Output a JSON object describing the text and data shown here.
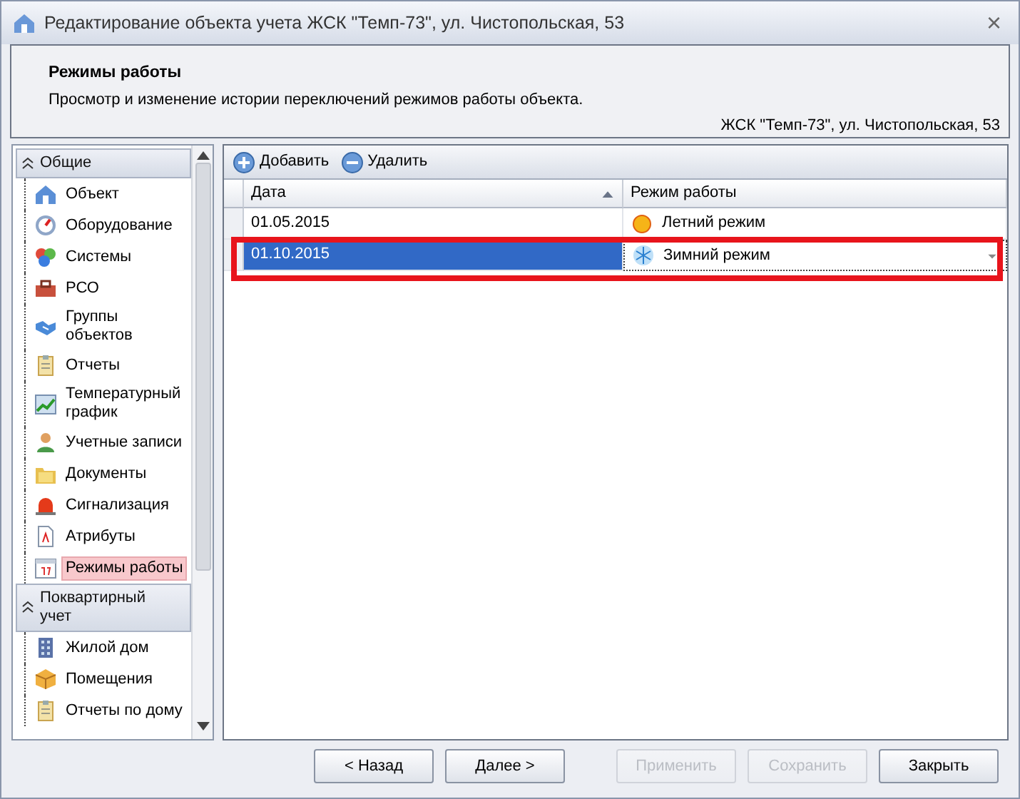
{
  "window": {
    "title": "Редактирование объекта учета ЖСК \"Темп-73\", ул. Чистопольская, 53",
    "close": "×"
  },
  "header": {
    "title": "Режимы работы",
    "description": "Просмотр и изменение истории переключений режимов работы объекта.",
    "object": "ЖСК \"Темп-73\", ул. Чистопольская, 53"
  },
  "sidebar": {
    "groups": [
      {
        "label": "Общие",
        "expanded": true,
        "items": [
          {
            "label": "Объект",
            "selected": false
          },
          {
            "label": "Оборудование",
            "selected": false
          },
          {
            "label": "Системы",
            "selected": false
          },
          {
            "label": "РСО",
            "selected": false
          },
          {
            "label": "Группы объектов",
            "selected": false
          },
          {
            "label": "Отчеты",
            "selected": false
          },
          {
            "label": "Температурный график",
            "selected": false
          },
          {
            "label": "Учетные записи",
            "selected": false
          },
          {
            "label": "Документы",
            "selected": false
          },
          {
            "label": "Сигнализация",
            "selected": false
          },
          {
            "label": "Атрибуты",
            "selected": false
          },
          {
            "label": "Режимы работы",
            "selected": true
          }
        ]
      },
      {
        "label": "Поквартирный учет",
        "expanded": true,
        "items": [
          {
            "label": "Жилой дом",
            "selected": false
          },
          {
            "label": "Помещения",
            "selected": false
          },
          {
            "label": "Отчеты по дому",
            "selected": false
          }
        ]
      }
    ]
  },
  "toolbar": [
    {
      "label": "Добавить",
      "kind": "add"
    },
    {
      "label": "Удалить",
      "kind": "remove"
    }
  ],
  "table": {
    "columns": [
      {
        "label": "Дата",
        "sorted": true
      },
      {
        "label": "Режим работы",
        "sorted": false
      }
    ],
    "rows": [
      {
        "date": "01.05.2015",
        "mode": "Летний режим",
        "kind": "summer",
        "selected": false,
        "highlighted": false
      },
      {
        "date": "01.10.2015",
        "mode": "Зимний режим",
        "kind": "winter",
        "selected": true,
        "highlighted": true
      }
    ]
  },
  "buttons": [
    {
      "label": "< Назад",
      "disabled": false
    },
    {
      "label": "Далее >",
      "disabled": false
    },
    {
      "label": "Применить",
      "disabled": true
    },
    {
      "label": "Сохранить",
      "disabled": true
    },
    {
      "label": "Закрыть",
      "disabled": false
    }
  ]
}
